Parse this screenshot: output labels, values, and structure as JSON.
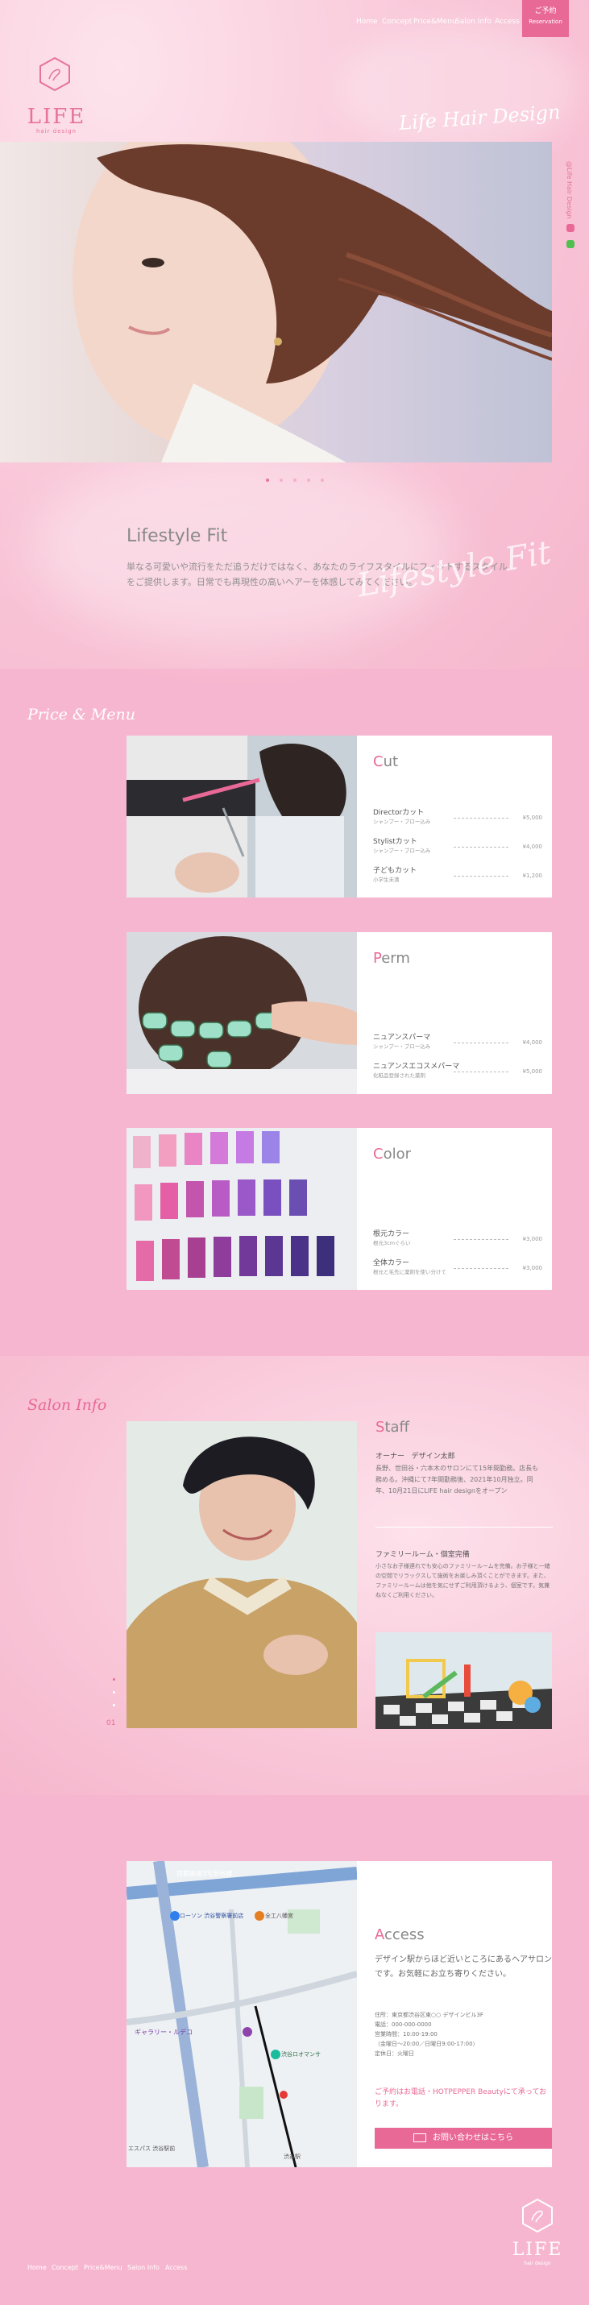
{
  "header": {
    "brand": "LIFE",
    "brand_sub": "hair design",
    "nav": [
      "Home",
      "Concept",
      "Price&Menu",
      "Salon Info",
      "Access"
    ],
    "reserve_label": "ご予約",
    "reserve_sub": "Reservation",
    "tagline": "Life Hair Design",
    "side_label": "@Life Hair Design"
  },
  "hero": {
    "slide_count": 5,
    "active_slide": 1
  },
  "concept": {
    "title": "Lifestyle Fit",
    "body": "単なる可愛いや流行をただ追うだけではなく、あなたのライフスタイルにフィットするスタイルをご提供します。日常でも再現性の高いヘアーを体感してみてください。",
    "script": "Lifestyle Fit"
  },
  "price_menu": {
    "section_title": "Price & Menu",
    "cards": [
      {
        "title_initial": "C",
        "title_rest": "ut",
        "items": [
          {
            "name": "Directorカット",
            "sub": "シャンプー・ブロー込み",
            "price": "¥5,000"
          },
          {
            "name": "Stylistカット",
            "sub": "シャンプー・ブロー込み",
            "price": "¥4,000"
          },
          {
            "name": "子どもカット",
            "sub": "小学生未満",
            "price": "¥1,200"
          }
        ]
      },
      {
        "title_initial": "P",
        "title_rest": "erm",
        "items": [
          {
            "name": "ニュアンスパーマ",
            "sub": "シャンプー・ブロー込み",
            "price": "¥4,000"
          },
          {
            "name": "ニュアンスエコスメパーマ",
            "sub": "化粧品登録された薬剤",
            "price": "¥5,000"
          }
        ]
      },
      {
        "title_initial": "C",
        "title_rest": "olor",
        "items": [
          {
            "name": "根元カラー",
            "sub": "根元3cmぐらい",
            "price": "¥3,000"
          },
          {
            "name": "全体カラー",
            "sub": "根元と毛先に薬剤を使い分けて",
            "price": "¥3,000"
          }
        ]
      }
    ]
  },
  "salon_info": {
    "section_title": "Salon Info",
    "staff_title_initial": "S",
    "staff_title_rest": "taff",
    "owner_role": "オーナー",
    "owner_name": "デザイン太郎",
    "owner_bio": "長野、世田谷・六本木のサロンにて15年間勤務。店長も務める。沖縄にて7年間勤務後、2021年10月独立。同年、10月21日にLIFE hair designをオープン",
    "family_title": "ファミリールーム・個室完備",
    "family_body": "小さなお子様連れでも安心のファミリールームを完備。お子様と一緒の空間でリラックスして施術をお楽しみ頂くことができます。また、ファミリールームは他を気にせずご利用頂けるよう、個室です。気兼ねなくご利用ください。",
    "page_indicator": "01"
  },
  "access": {
    "title_initial": "A",
    "title_rest": "ccess",
    "lead": "デザイン駅からほど近いところにあるヘアサロンです。お気軽にお立ち寄りください。",
    "address": "住所：東京都渋谷区東○○ デザインビル3F",
    "tel": "電話：000-000-0000",
    "hours": "営業時間：10:00-19:00",
    "hours_note": "（金曜日～20:00／日曜日9:00-17:00）",
    "closed": "定休日：火曜日",
    "reserve_note": "ご予約はお電話・HOTPEPPER Beautyにて承っております。",
    "contact_label": "お問い合わせはこちら",
    "map_labels": [
      "首都高速3号渋谷線",
      "ローソン 渋谷警察署前店",
      "全工八幡宮",
      "ギャラリー・ルデコ",
      "渋谷ロオマンサ",
      "エスパス 渋谷駅前",
      "渋谷駅"
    ]
  },
  "footer": {
    "brand": "LIFE",
    "brand_sub": "hair design",
    "nav": [
      "Home",
      "Concept",
      "Price&Menu",
      "Salon Info",
      "Access"
    ]
  },
  "colors": {
    "accent": "#e96996",
    "pink_bg": "#f7b6cf"
  }
}
